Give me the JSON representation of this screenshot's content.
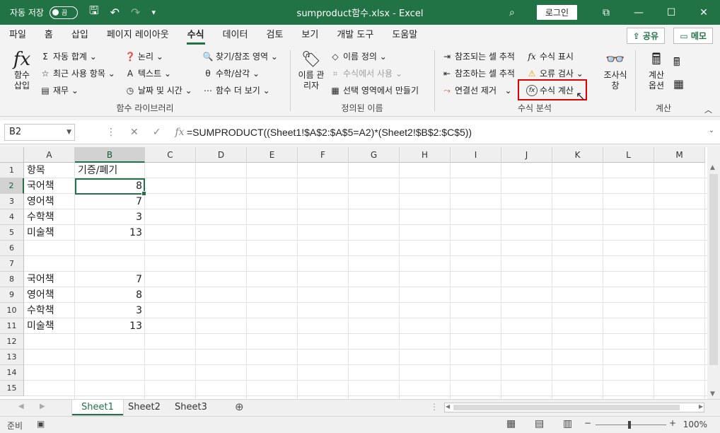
{
  "titlebar": {
    "autosave_label": "자동 저장",
    "autosave_state": "끔",
    "doc_title": "sumproduct함수.xlsx  -  Excel",
    "login": "로그인"
  },
  "tabs": [
    "파일",
    "홈",
    "삽입",
    "페이지 레이아웃",
    "수식",
    "데이터",
    "검토",
    "보기",
    "개발 도구",
    "도움말"
  ],
  "share": "공유",
  "memo": "메모",
  "ribbon": {
    "insert_function": "함수 삽입",
    "autosum": "자동 합계",
    "recent": "최근 사용 항목",
    "financial": "재무",
    "logical": "논리",
    "text": "텍스트",
    "datetime": "날짜 및 시간",
    "lookup": "찾기/참조 영역",
    "math": "수학/삼각",
    "more": "함수 더 보기",
    "library_label": "함수 라이브러리",
    "name_manager": "이름 관리자",
    "define_name": "이름 정의",
    "use_in_formula": "수식에서 사용",
    "create_from_sel": "선택 영역에서 만들기",
    "defined_names_label": "정의된 이름",
    "trace_precedents": "참조되는 셀 추적",
    "trace_dependents": "참조하는 셀 추적",
    "remove_arrows": "연결선 제거",
    "show_formulas": "수식 표시",
    "error_checking": "오류 검사",
    "evaluate_formula": "수식 계산",
    "auditing_label": "수식 분석",
    "watch_window": "조사식 창",
    "calc_options": "계산 옵션",
    "calc_label": "계산"
  },
  "formula_bar": {
    "name_box": "B2",
    "formula": "=SUMPRODUCT((Sheet1!$A$2:$A$5=A2)*(Sheet2!$B$2:$C$5))"
  },
  "columns": [
    "A",
    "B",
    "C",
    "D",
    "E",
    "F",
    "G",
    "H",
    "I",
    "J",
    "K",
    "L",
    "M"
  ],
  "rows": [
    "1",
    "2",
    "3",
    "4",
    "5",
    "6",
    "7",
    "8",
    "9",
    "10",
    "11",
    "12",
    "13",
    "14",
    "15"
  ],
  "cells": {
    "A1": "항목",
    "B1": "기증/폐기",
    "A2": "국어책",
    "B2": "8",
    "A3": "영어책",
    "B3": "7",
    "A4": "수학책",
    "B4": "3",
    "A5": "미술책",
    "B5": "13",
    "A8": "국어책",
    "B8": "7",
    "A9": "영어책",
    "B9": "8",
    "A10": "수학책",
    "B10": "3",
    "A11": "미술책",
    "B11": "13"
  },
  "sheets": [
    "Sheet1",
    "Sheet2",
    "Sheet3"
  ],
  "status": {
    "ready": "준비",
    "zoom": "100%"
  }
}
